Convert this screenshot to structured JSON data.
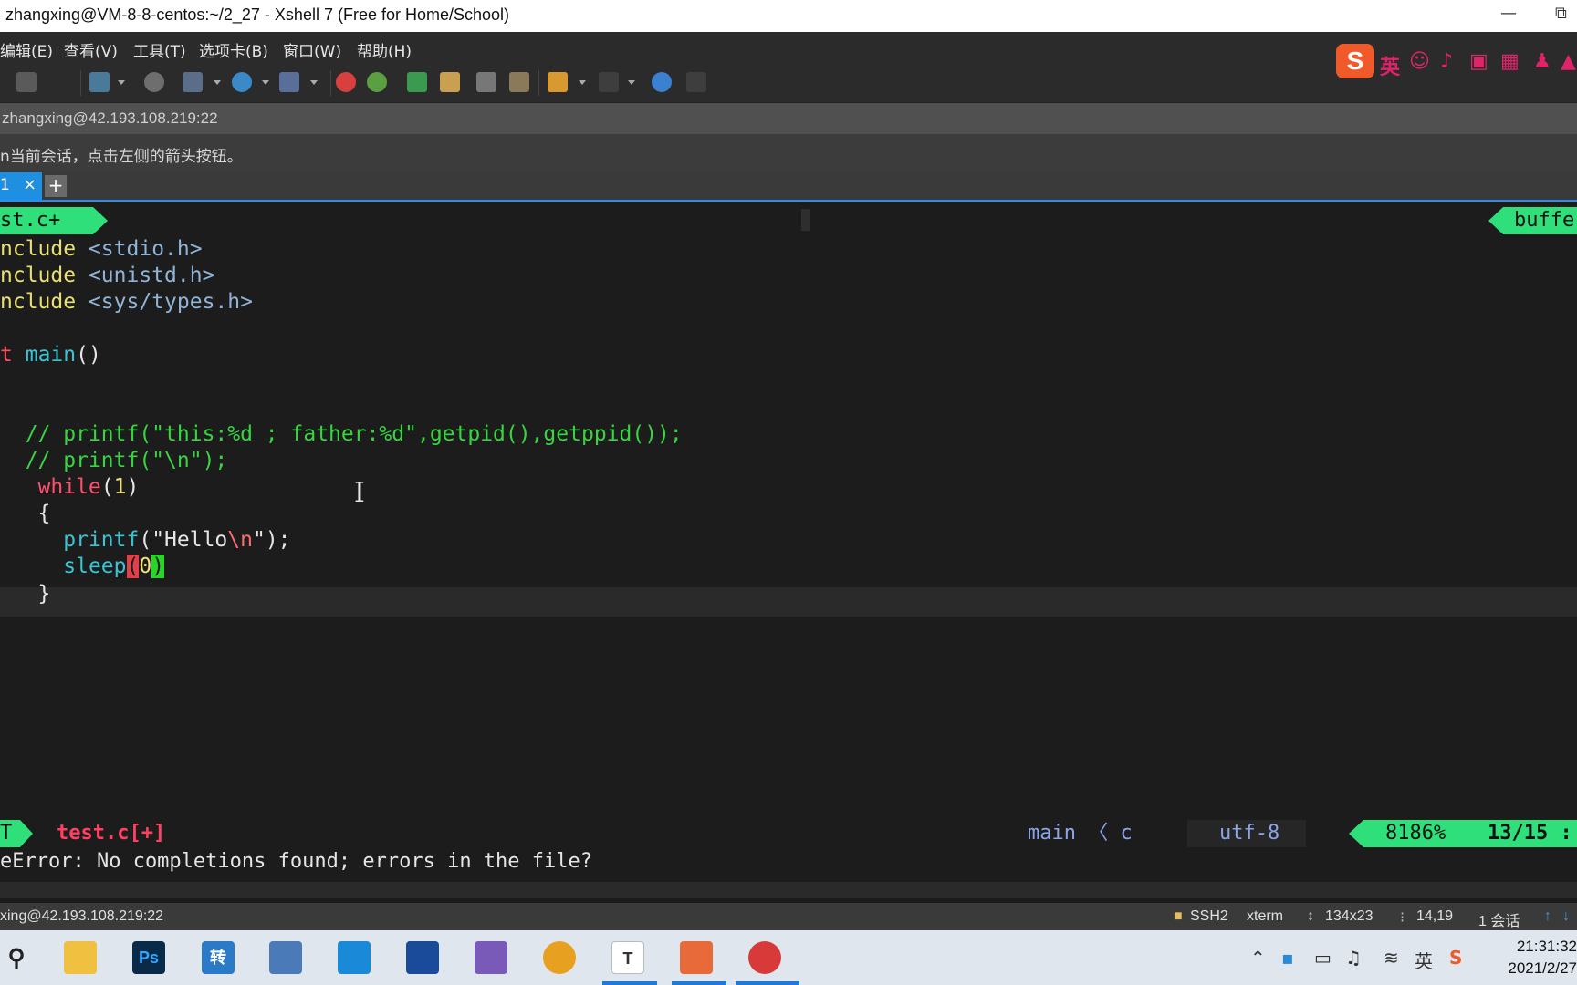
{
  "window": {
    "title": "zhangxing@VM-8-8-centos:~/2_27 - Xshell 7 (Free for Home/School)",
    "minimize": "—",
    "restore": "⧉"
  },
  "menu": {
    "items": [
      "编辑(E)",
      "查看(V)",
      "工具(T)",
      "选项卡(B)",
      "窗口(W)",
      "帮助(H)"
    ]
  },
  "ime": {
    "logo": "S",
    "lang": "英"
  },
  "address": {
    "text": "zhangxing@42.193.108.219:22"
  },
  "info": {
    "text": "n当前会话，点击左侧的箭头按钮。"
  },
  "tabs": {
    "current_label": "1",
    "close": "×",
    "add": "+"
  },
  "vim": {
    "tabline_left": "st.c+",
    "tabline_right": "buffe",
    "code": {
      "l1_kw": "nclude",
      "l1_hdr": "<stdio.h>",
      "l2_kw": "nclude",
      "l2_hdr": "<unistd.h>",
      "l3_kw": "nclude",
      "l3_hdr": "<sys/types.h>",
      "l5_type": "t",
      "l5_fn": "main",
      "l5_rest": "()",
      "l8_comment": "// printf(\"this:%d ; father:%d\",getpid(),getppid());",
      "l9_comment": "// printf(\"\\n\");",
      "l10_kw": "while",
      "l10_open": "(",
      "l10_num": "1",
      "l10_close": ")",
      "l11": "{",
      "l12_fn": "printf",
      "l12_open": "(\"Hello",
      "l12_esc": "\\n",
      "l12_close": "\");",
      "l13_fn": "sleep",
      "l13_open": "(",
      "l13_num": "0",
      "l13_close": ")",
      "l14": "}"
    },
    "status": {
      "mode": "T",
      "file": "test.c[+]",
      "func": "main 〈 c",
      "encoding": "utf-8",
      "percent": "8186%",
      "line": "13/15 :"
    },
    "message": "eError: No completions found; errors in the file?"
  },
  "xshell_status": {
    "host": "xing@42.193.108.219:22",
    "protocol": "SSH2",
    "term": "xterm",
    "size": "134x23",
    "cursor": "14,19",
    "sessions": "1 会话"
  },
  "taskbar": {
    "icons": [
      "search-icon",
      "file-explorer-icon",
      "photoshop-icon",
      "convert-icon",
      "notes-icon",
      "vscode-icon",
      "app-icon",
      "visual-studio-icon",
      "chrome-icon",
      "typora-icon",
      "powerpoint-icon",
      "xshell-icon"
    ],
    "ps_label": "Ps",
    "convert_label": "转",
    "typora_label": "T",
    "tray_lang": "英",
    "time": "21:31:32",
    "date": "2021/2/27"
  },
  "colors": {
    "accent_green": "#2fe07a",
    "tab_blue": "#1e8fe1",
    "comment_green": "#36d640",
    "keyword_red": "#ff4f6b"
  }
}
